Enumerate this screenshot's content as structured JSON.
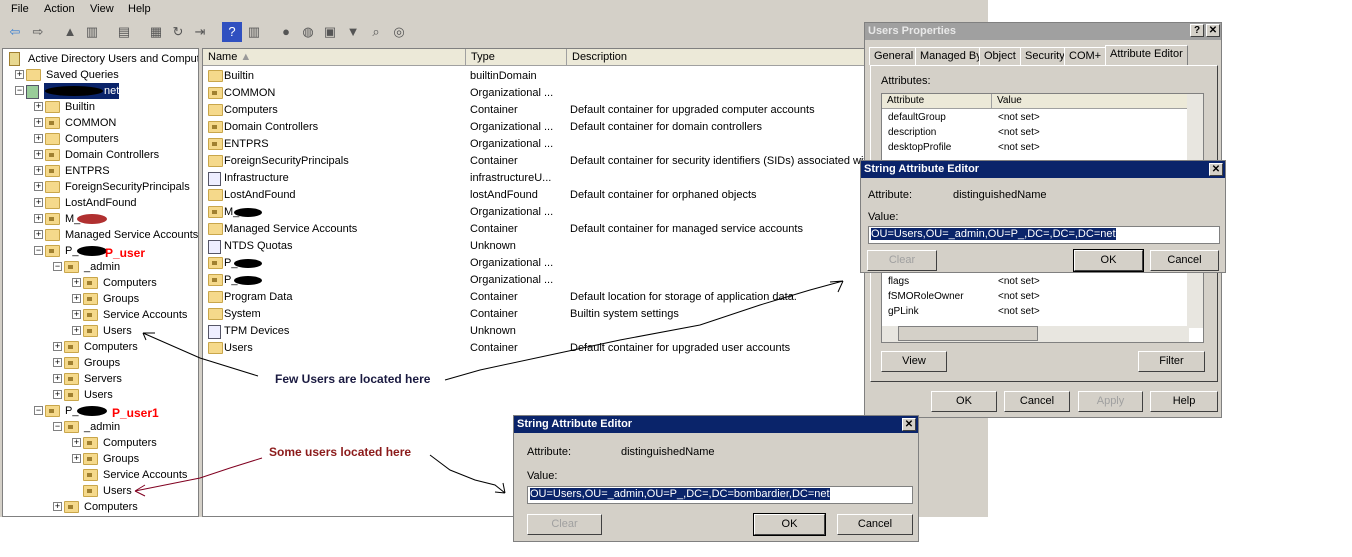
{
  "menu": [
    "File",
    "Action",
    "View",
    "Help"
  ],
  "toolbar_icons": [
    "back-icon",
    "forward-icon",
    "up-folder-icon",
    "show-hide-tree-icon",
    "clipboard-icon",
    "properties-icon",
    "refresh-icon",
    "export-list-icon",
    "help-icon",
    "action-pane-icon",
    "user-icon",
    "group-icon",
    "ou-icon",
    "filter-icon",
    "find-icon",
    "delegate-icon"
  ],
  "tree": {
    "root": "Active Directory Users and Comput",
    "items": [
      {
        "label": "Saved Queries",
        "level": 1,
        "exp": "+",
        "icon": "folder"
      },
      {
        "label": "net",
        "level": 1,
        "exp": "-",
        "icon": "domain",
        "selected": true
      },
      {
        "label": "Builtin",
        "level": 2,
        "exp": "+",
        "icon": "folder"
      },
      {
        "label": "COMMON",
        "level": 2,
        "exp": "+",
        "icon": "ou"
      },
      {
        "label": "Computers",
        "level": 2,
        "exp": "+",
        "icon": "folder"
      },
      {
        "label": "Domain Controllers",
        "level": 2,
        "exp": "+",
        "icon": "ou"
      },
      {
        "label": "ENTPRS",
        "level": 2,
        "exp": "+",
        "icon": "ou"
      },
      {
        "label": "ForeignSecurityPrincipals",
        "level": 2,
        "exp": "+",
        "icon": "folder"
      },
      {
        "label": "LostAndFound",
        "level": 2,
        "exp": "+",
        "icon": "folder"
      },
      {
        "label": "M_",
        "level": 2,
        "exp": "+",
        "icon": "ou"
      },
      {
        "label": "Managed Service Accounts",
        "level": 2,
        "exp": "+",
        "icon": "folder"
      },
      {
        "label": "P_",
        "level": 2,
        "exp": "-",
        "icon": "ou"
      },
      {
        "label": "_admin",
        "level": 3,
        "exp": "-",
        "icon": "ou"
      },
      {
        "label": "Computers",
        "level": 4,
        "exp": "+",
        "icon": "ou"
      },
      {
        "label": "Groups",
        "level": 4,
        "exp": "+",
        "icon": "ou"
      },
      {
        "label": "Service Accounts",
        "level": 4,
        "exp": "+",
        "icon": "ou"
      },
      {
        "label": "Users",
        "level": 4,
        "exp": "+",
        "icon": "ou"
      },
      {
        "label": "Computers",
        "level": 3,
        "exp": "+",
        "icon": "ou"
      },
      {
        "label": "Groups",
        "level": 3,
        "exp": "+",
        "icon": "ou"
      },
      {
        "label": "Servers",
        "level": 3,
        "exp": "+",
        "icon": "ou"
      },
      {
        "label": "Users",
        "level": 3,
        "exp": "+",
        "icon": "ou"
      },
      {
        "label": "P_",
        "level": 2,
        "exp": "-",
        "icon": "ou"
      },
      {
        "label": "_admin",
        "level": 3,
        "exp": "-",
        "icon": "ou"
      },
      {
        "label": "Computers",
        "level": 4,
        "exp": "+",
        "icon": "ou"
      },
      {
        "label": "Groups",
        "level": 4,
        "exp": "+",
        "icon": "ou"
      },
      {
        "label": "Service Accounts",
        "level": 4,
        "exp": "",
        "icon": "ou"
      },
      {
        "label": "Users",
        "level": 4,
        "exp": "",
        "icon": "ou"
      },
      {
        "label": "Computers",
        "level": 3,
        "exp": "+",
        "icon": "ou"
      }
    ]
  },
  "list": {
    "columns": [
      "Name",
      "Type",
      "Description"
    ],
    "rows": [
      {
        "name": "Builtin",
        "type": "builtinDomain",
        "desc": "",
        "icon": "folder"
      },
      {
        "name": "COMMON",
        "type": "Organizational ...",
        "desc": "",
        "icon": "ou"
      },
      {
        "name": "Computers",
        "type": "Container",
        "desc": "Default container for upgraded computer accounts",
        "icon": "folder"
      },
      {
        "name": "Domain Controllers",
        "type": "Organizational ...",
        "desc": "Default container for domain controllers",
        "icon": "ou"
      },
      {
        "name": "ENTPRS",
        "type": "Organizational ...",
        "desc": "",
        "icon": "ou"
      },
      {
        "name": "ForeignSecurityPrincipals",
        "type": "Container",
        "desc": "Default container for security identifiers (SIDs) associated with",
        "icon": "folder"
      },
      {
        "name": "Infrastructure",
        "type": "infrastructureU...",
        "desc": "",
        "icon": "object"
      },
      {
        "name": "LostAndFound",
        "type": "lostAndFound",
        "desc": "Default container for orphaned objects",
        "icon": "folder"
      },
      {
        "name": "M_",
        "type": "Organizational ...",
        "desc": "",
        "icon": "ou"
      },
      {
        "name": "Managed Service Accounts",
        "type": "Container",
        "desc": "Default container for managed service accounts",
        "icon": "folder"
      },
      {
        "name": "NTDS Quotas",
        "type": "Unknown",
        "desc": "",
        "icon": "object"
      },
      {
        "name": "P_",
        "type": "Organizational ...",
        "desc": "",
        "icon": "ou"
      },
      {
        "name": "P_",
        "type": "Organizational ...",
        "desc": "",
        "icon": "ou"
      },
      {
        "name": "Program Data",
        "type": "Container",
        "desc": "Default location for storage of application data.",
        "icon": "folder"
      },
      {
        "name": "System",
        "type": "Container",
        "desc": "Builtin system settings",
        "icon": "folder"
      },
      {
        "name": "TPM Devices",
        "type": "Unknown",
        "desc": "",
        "icon": "object"
      },
      {
        "name": "Users",
        "type": "Container",
        "desc": "Default container for upgraded user accounts",
        "icon": "folder"
      }
    ]
  },
  "props": {
    "title": "Users Properties",
    "tabs": [
      "General",
      "Managed By",
      "Object",
      "Security",
      "COM+",
      "Attribute Editor"
    ],
    "attributes_label": "Attributes:",
    "columns": [
      "Attribute",
      "Value"
    ],
    "rows_top": [
      [
        "defaultGroup",
        "<not set>"
      ],
      [
        "description",
        "<not set>"
      ],
      [
        "desktopProfile",
        "<not set>"
      ]
    ],
    "rows_bottom": [
      [
        "flags",
        "<not set>"
      ],
      [
        "fSMORoleOwner",
        "<not set>"
      ],
      [
        "gPLink",
        "<not set>"
      ]
    ],
    "view": "View",
    "filter": "Filter",
    "ok": "OK",
    "cancel": "Cancel",
    "apply": "Apply",
    "help": "Help"
  },
  "editor1": {
    "title": "String Attribute Editor",
    "attribute_label": "Attribute:",
    "attribute": "distinguishedName",
    "value_label": "Value:",
    "value": "OU=Users,OU=_admin,OU=P_,DC=,DC=,DC=net",
    "clear": "Clear",
    "ok": "OK",
    "cancel": "Cancel"
  },
  "editor2": {
    "title": "String Attribute Editor",
    "attribute_label": "Attribute:",
    "attribute": "distinguishedName",
    "value_label": "Value:",
    "value": "OU=Users,OU=_admin,OU=P_,DC=,DC=bombardier,DC=net",
    "clear": "Clear",
    "ok": "OK",
    "cancel": "Cancel"
  },
  "annotations": {
    "p_user": "P_user",
    "p_user1": "P_user1",
    "few_users": "Few Users are located here",
    "some_users": "Some users located here"
  },
  "colors": {
    "selection": "#0a246a",
    "annotation_red": "#ff0000",
    "annotation_darkred": "#8b0000",
    "dialog": "#d4d0c8"
  }
}
